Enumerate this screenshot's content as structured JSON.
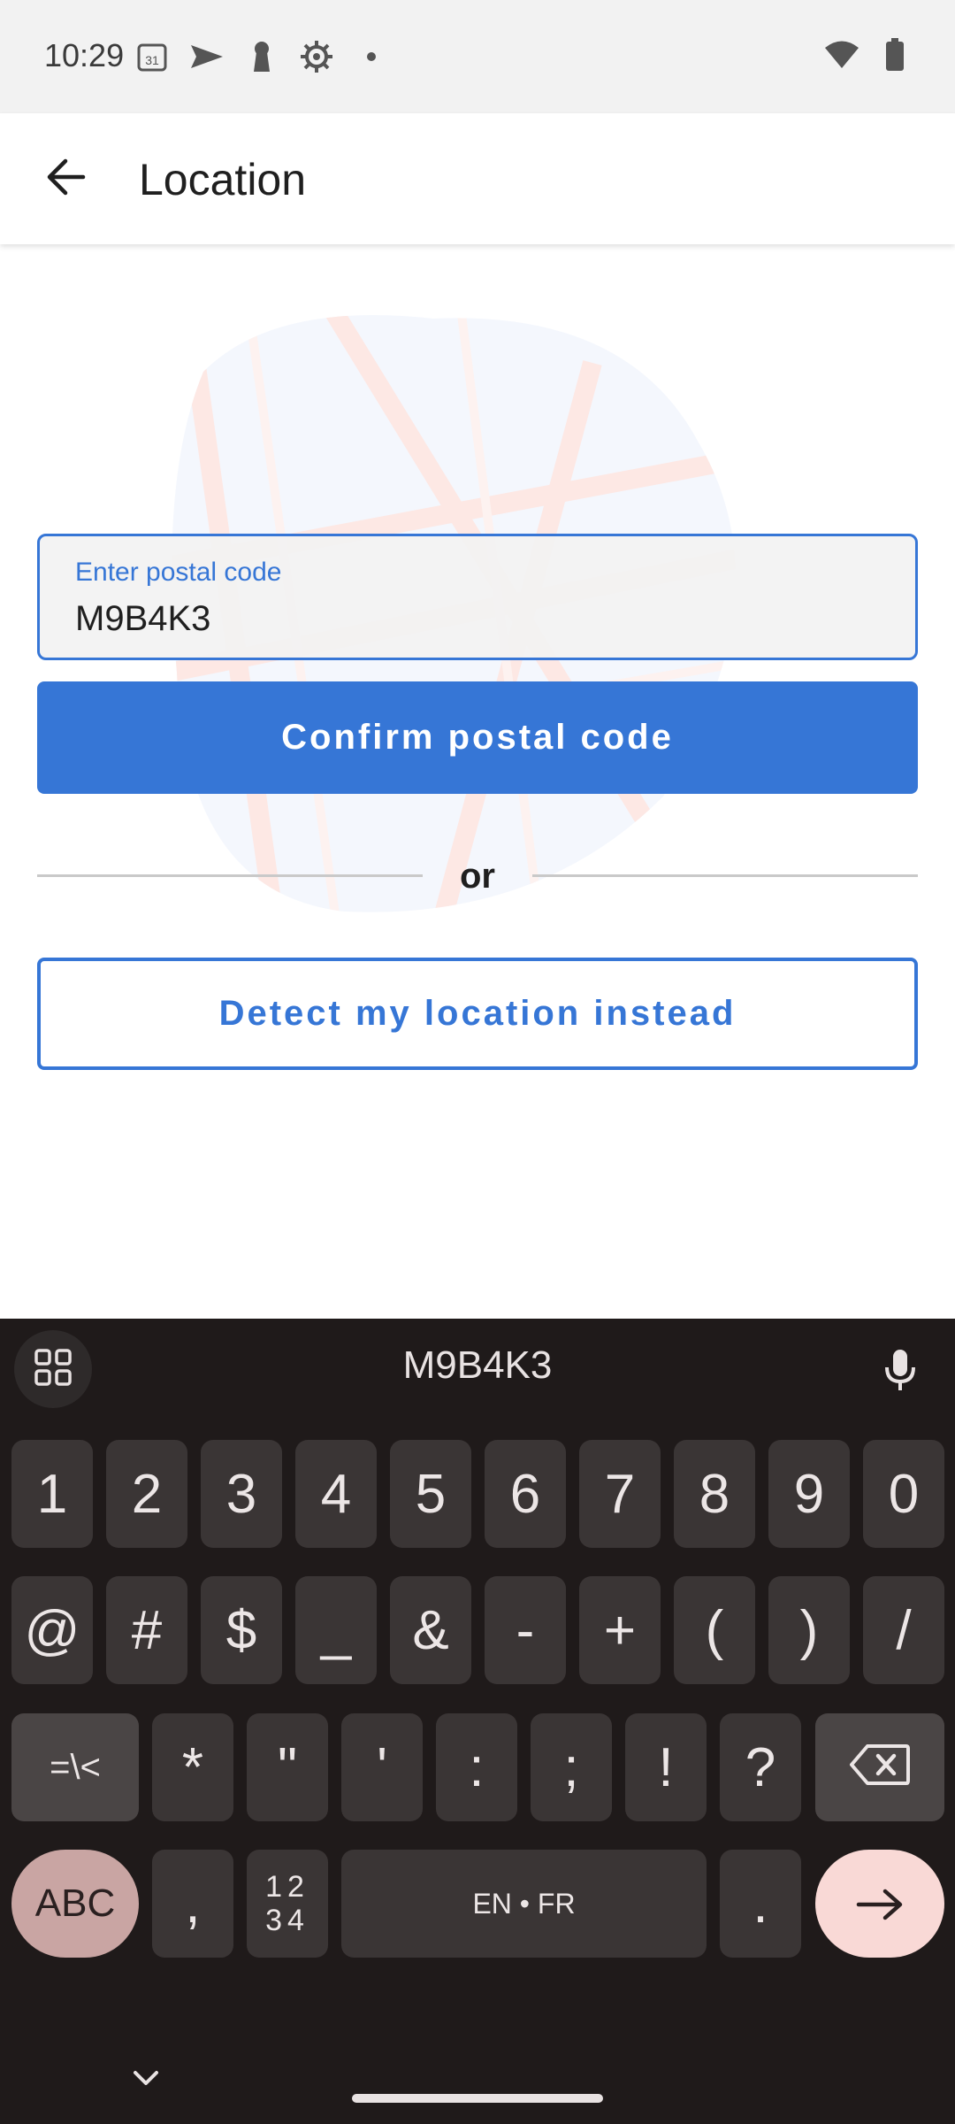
{
  "status_bar": {
    "time": "10:29",
    "left_icons": [
      "calendar-icon",
      "send-icon",
      "keyhole-icon",
      "settings-gear-icon",
      "dot-icon"
    ],
    "right_icons": [
      "wifi-icon",
      "battery-icon"
    ]
  },
  "app_bar": {
    "title": "Location",
    "back_icon": "arrow-left-icon"
  },
  "form": {
    "postal_label": "Enter postal code",
    "postal_value": "M9B4K3",
    "confirm_label": "Confirm postal code",
    "or_text": "or",
    "detect_label": "Detect my location instead"
  },
  "keyboard": {
    "suggestion": "M9B4K3",
    "row1": [
      "1",
      "2",
      "3",
      "4",
      "5",
      "6",
      "7",
      "8",
      "9",
      "0"
    ],
    "row2": [
      "@",
      "#",
      "$",
      "_",
      "&",
      "-",
      "+",
      "(",
      ")",
      "/"
    ],
    "row3": [
      "=\\<",
      "*",
      "\"",
      "'",
      ":",
      ";",
      "!",
      "?"
    ],
    "row4": {
      "abc": "ABC",
      "comma": ",",
      "numsym": "12\n34",
      "space": "EN • FR",
      "period": "."
    }
  },
  "colors": {
    "accent": "#3676d6",
    "keyboard_bg": "#1f1a1a",
    "key_bg": "#3a3535",
    "abc_key": "#c9a5a3",
    "enter_key": "#f9d9d6"
  }
}
